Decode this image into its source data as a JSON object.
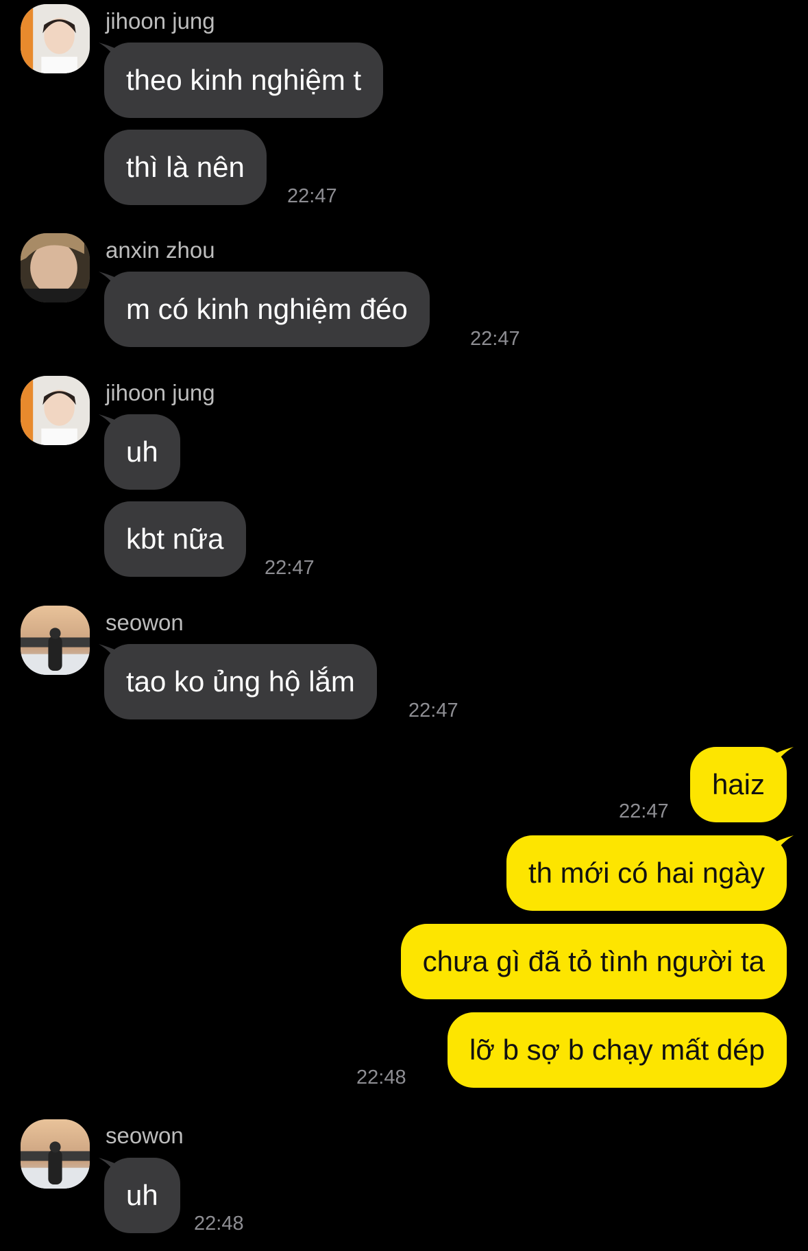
{
  "messages": [
    {
      "sender": "jihoon jung",
      "avatar_icon": "profile-photo-icon",
      "lines": [
        "theo kinh nghiệm t",
        "thì là nên"
      ],
      "time": "22:47"
    },
    {
      "sender": "anxin zhou",
      "avatar_icon": "profile-photo-icon",
      "lines": [
        "m có kinh nghiệm đéo"
      ],
      "time": "22:47"
    },
    {
      "sender": "jihoon jung",
      "avatar_icon": "profile-photo-icon",
      "lines": [
        "uh",
        "kbt nữa"
      ],
      "time": "22:47"
    },
    {
      "sender": "seowon",
      "avatar_icon": "profile-photo-icon",
      "lines": [
        "tao ko ủng hộ lắm"
      ],
      "time": "22:47"
    },
    {
      "sender": "me",
      "lines": [
        "haiz"
      ],
      "time": "22:47"
    },
    {
      "sender": "me",
      "lines": [
        "th mới có hai ngày",
        "chưa gì đã tỏ tình người ta",
        "lỡ b sợ b chạy mất dép"
      ],
      "time": "22:48"
    },
    {
      "sender": "seowon",
      "avatar_icon": "profile-photo-icon",
      "lines": [
        "uh"
      ],
      "time": "22:48"
    }
  ],
  "colors": {
    "background": "#000000",
    "incoming_bubble": "#3a3a3c",
    "outgoing_bubble": "#fde500",
    "timestamp": "#8e8e93"
  }
}
